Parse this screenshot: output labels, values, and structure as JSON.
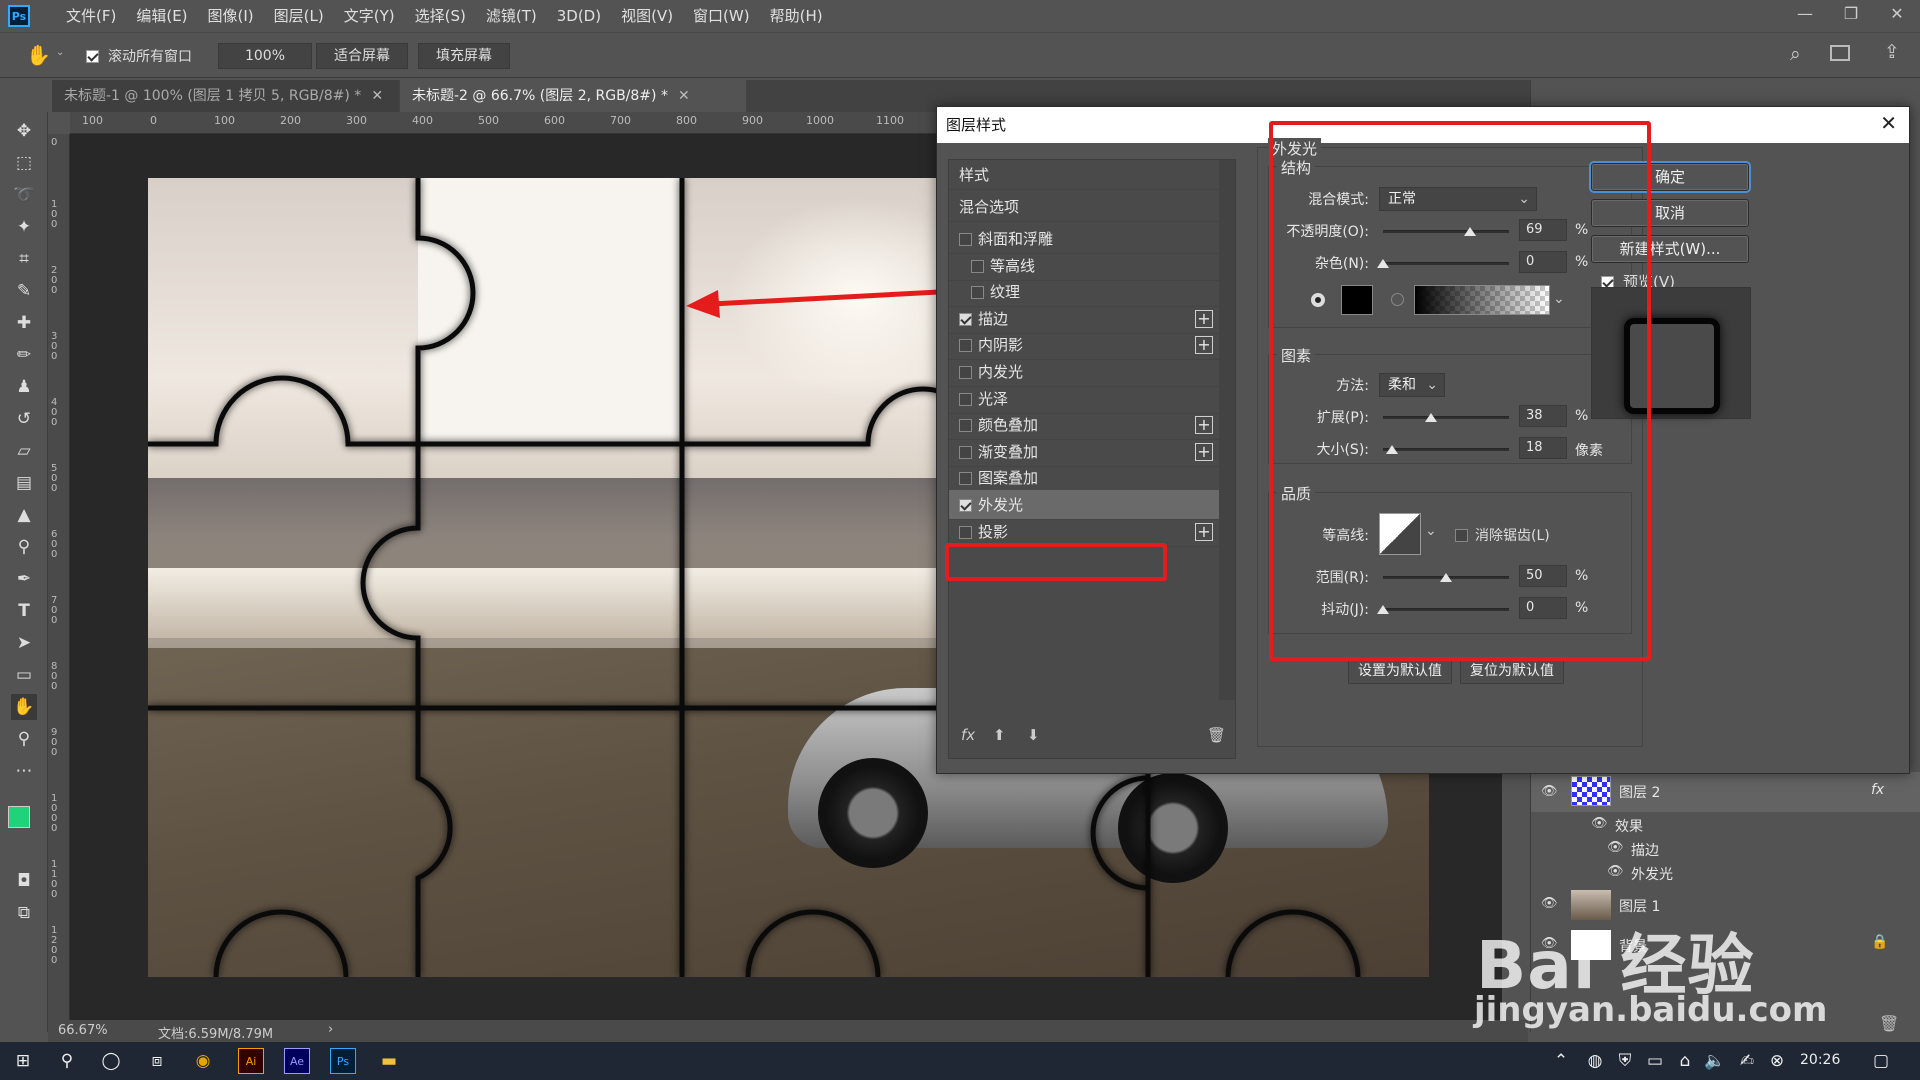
{
  "app": {
    "logo": "Ps"
  },
  "menu": [
    "文件(F)",
    "编辑(E)",
    "图像(I)",
    "图层(L)",
    "文字(Y)",
    "选择(S)",
    "滤镜(T)",
    "3D(D)",
    "视图(V)",
    "窗口(W)",
    "帮助(H)"
  ],
  "window_controls": {
    "minimize": "—",
    "restore": "❐",
    "close": "✕"
  },
  "options": {
    "scroll_all_label": "滚动所有窗口",
    "zoom_value": "100%",
    "fit_screen": "适合屏幕",
    "fill_screen": "填充屏幕"
  },
  "tabs": [
    {
      "label": "未标题-1 @ 100% (图层 1 拷贝 5, RGB/8#) *"
    },
    {
      "label": "未标题-2 @ 66.7% (图层 2, RGB/8#) *"
    }
  ],
  "ruler_top": [
    "100",
    "0",
    "100",
    "200",
    "300",
    "400",
    "500",
    "600",
    "700",
    "800",
    "900",
    "1000",
    "1100"
  ],
  "ruler_left": [
    "0",
    "100",
    "200",
    "300",
    "400",
    "500",
    "600",
    "700",
    "800",
    "900",
    "1000",
    "1100",
    "1200"
  ],
  "dialog": {
    "title": "图层样式",
    "close": "✕",
    "list_header": "样式",
    "blend_options": "混合选项",
    "styles": [
      {
        "label": "斜面和浮雕",
        "checked": false,
        "plus": false,
        "indent": false
      },
      {
        "label": "等高线",
        "checked": false,
        "plus": false,
        "indent": true
      },
      {
        "label": "纹理",
        "checked": false,
        "plus": false,
        "indent": true
      },
      {
        "label": "描边",
        "checked": true,
        "plus": true,
        "indent": false
      },
      {
        "label": "内阴影",
        "checked": false,
        "plus": true,
        "indent": false
      },
      {
        "label": "内发光",
        "checked": false,
        "plus": false,
        "indent": false
      },
      {
        "label": "光泽",
        "checked": false,
        "plus": false,
        "indent": false
      },
      {
        "label": "颜色叠加",
        "checked": false,
        "plus": true,
        "indent": false
      },
      {
        "label": "渐变叠加",
        "checked": false,
        "plus": true,
        "indent": false
      },
      {
        "label": "图案叠加",
        "checked": false,
        "plus": false,
        "indent": false
      },
      {
        "label": "外发光",
        "checked": true,
        "plus": false,
        "indent": false,
        "selected": true
      },
      {
        "label": "投影",
        "checked": false,
        "plus": true,
        "indent": false
      }
    ],
    "footer_fx": "fx",
    "outer_glow": {
      "title": "外发光",
      "structure": {
        "title": "结构",
        "blend_mode_label": "混合模式:",
        "blend_mode": "正常",
        "opacity_label": "不透明度(O):",
        "opacity": "69",
        "opacity_value": 69,
        "noise_label": "杂色(N):",
        "noise": "0",
        "noise_value": 0,
        "percent": "%",
        "color": "#000000"
      },
      "elements": {
        "title": "图素",
        "technique_label": "方法:",
        "technique": "柔和",
        "spread_label": "扩展(P):",
        "spread": "38",
        "spread_value": 38,
        "size_label": "大小(S):",
        "size": "18",
        "size_value": 18,
        "size_unit": "像素"
      },
      "quality": {
        "title": "品质",
        "contour_label": "等高线:",
        "antialias_label": "消除锯齿(L)",
        "range_label": "范围(R):",
        "range": "50",
        "range_value": 50,
        "jitter_label": "抖动(J):",
        "jitter": "0",
        "jitter_value": 0
      },
      "set_default": "设置为默认值",
      "reset_default": "复位为默认值"
    },
    "buttons": {
      "ok": "确定",
      "cancel": "取消",
      "new_style": "新建样式(W)...",
      "preview": "预览(V)"
    }
  },
  "layers": {
    "layer2": "图层 2",
    "fx_badge": "fx",
    "effects": "效果",
    "effect_stroke": "描边",
    "effect_outer_glow": "外发光",
    "layer1": "图层 1",
    "background": "背景"
  },
  "status": {
    "zoom": "66.67%",
    "doc": "文档:6.59M/8.79M",
    "arrow": "›"
  },
  "taskbar": {
    "time": "20:26"
  },
  "watermark": {
    "brand": "Bai 经验",
    "url": "jingyan.baidu.com"
  },
  "colors": {
    "highlight_red": "#e51c1c",
    "foreground_swatch": "#1fd37a",
    "ps_blue": "#31a8ff"
  }
}
